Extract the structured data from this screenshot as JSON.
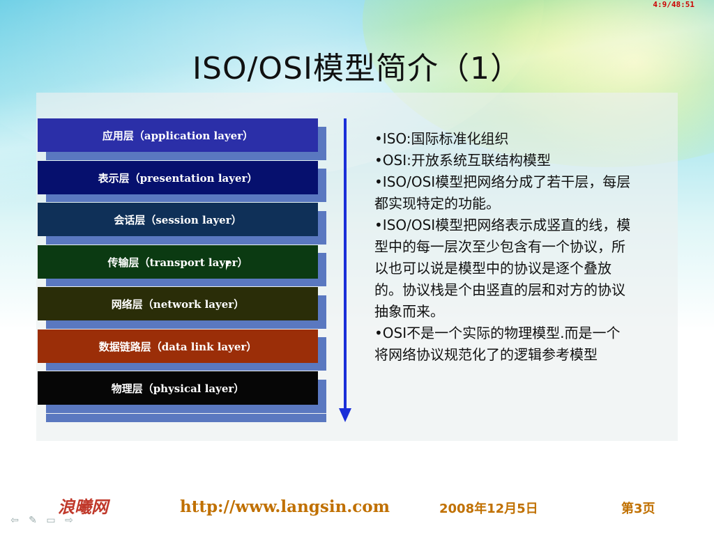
{
  "slide": {
    "timer": "4:9/48:51",
    "title": "ISO/OSI模型简介（1）",
    "layers": [
      {
        "label": "应用层（application layer）",
        "color": "#2b2fa8"
      },
      {
        "label": "表示层（presentation layer）",
        "color": "#06106e"
      },
      {
        "label": "会话层（session layer）",
        "color": "#0f3058"
      },
      {
        "label": "传输层（transport layer）",
        "color": "#0b3a12"
      },
      {
        "label": "网络层（network layer）",
        "color": "#2a2d08"
      },
      {
        "label": "数据链路层（data link layer）",
        "color": "#9b2e08"
      },
      {
        "label": "物理层（physical layer）",
        "color": "#060606"
      }
    ],
    "arrow_color": "#1a2fd8",
    "description": [
      "•ISO:国际标准化组织",
      "•OSI:开放系统互联结构模型",
      "•ISO/OSI模型把网络分成了若干层，每层都实现特定的功能。",
      "•ISO/OSI模型把网络表示成竖直的线，模型中的每一层次至少包含有一个协议，所以也可以说是模型中的协议是逐个叠放的。协议栈是个由竖直的层和对方的协议抽象而来。",
      "•OSI不是一个实际的物理模型.而是一个将网络协议规范化了的逻辑参考模型"
    ]
  },
  "footer": {
    "logo": "浪曦网",
    "url": "http://www.langsin.com",
    "date": "2008年12月5日",
    "page": "第3页"
  },
  "nav": {
    "back_icon": "arrow-left-icon",
    "pen_icon": "pen-icon",
    "menu_icon": "menu-icon",
    "forward_icon": "arrow-right-icon"
  }
}
